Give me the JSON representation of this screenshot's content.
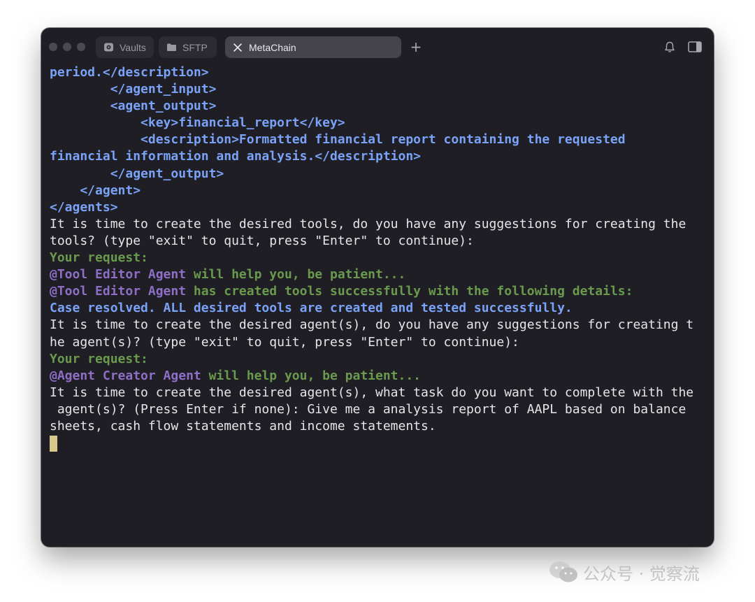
{
  "tabs": [
    {
      "label": "Vaults",
      "icon": "vaults-icon",
      "active": false
    },
    {
      "label": "SFTP",
      "icon": "folder-icon",
      "active": false
    },
    {
      "label": "MetaChain",
      "icon": "close-icon",
      "active": true
    }
  ],
  "toolbar": {
    "new_tab_symbol": "+",
    "icons": [
      "bell-icon",
      "sidebar-toggle-icon"
    ]
  },
  "terminal": {
    "lines": [
      [
        {
          "t": "period.</description>",
          "s": "tag"
        }
      ],
      [
        {
          "t": "        </agent_input>",
          "s": "tag"
        }
      ],
      [
        {
          "t": "        <agent_output>",
          "s": "tag"
        }
      ],
      [
        {
          "t": "            <key>financial_report</key>",
          "s": "tag"
        }
      ],
      [
        {
          "t": "            <description>Formatted financial report containing the requested",
          "s": "tag"
        }
      ],
      [
        {
          "t": "financial information and analysis.</description>",
          "s": "tag"
        }
      ],
      [
        {
          "t": "        </agent_output>",
          "s": "tag"
        }
      ],
      [
        {
          "t": "    </agent>",
          "s": "tag"
        }
      ],
      [
        {
          "t": "</agents>",
          "s": "tag"
        }
      ],
      [
        {
          "t": "It is time to create the desired tools, do you have any suggestions for creating the",
          "s": "plain"
        }
      ],
      [
        {
          "t": "tools? (type \"exit\" to quit, press \"Enter\" to continue):",
          "s": "plain"
        }
      ],
      [
        {
          "t": "Your request:",
          "s": "green"
        }
      ],
      [
        {
          "t": "@Tool Editor Agent",
          "s": "purple"
        },
        {
          "t": " will help you, be patient...",
          "s": "green"
        }
      ],
      [
        {
          "t": "@Tool Editor Agent",
          "s": "purple"
        },
        {
          "t": " has created tools successfully with the following details:",
          "s": "green"
        }
      ],
      [
        {
          "t": "Case resolved. ALL desired tools are created and tested successfully.",
          "s": "blue"
        }
      ],
      [
        {
          "t": "It is time to create the desired agent(s), do you have any suggestions for creating t",
          "s": "plain"
        }
      ],
      [
        {
          "t": "he agent(s)? (type \"exit\" to quit, press \"Enter\" to continue):",
          "s": "plain"
        }
      ],
      [
        {
          "t": "Your request:",
          "s": "green"
        }
      ],
      [
        {
          "t": "@Agent Creator Agent",
          "s": "purple"
        },
        {
          "t": " will help you, be patient...",
          "s": "green"
        }
      ],
      [
        {
          "t": "It is time to create the desired agent(s), what task do you want to complete with the",
          "s": "plain"
        }
      ],
      [
        {
          "t": " agent(s)? (Press Enter if none): Give me a analysis report of AAPL based on balance",
          "s": "plain"
        }
      ],
      [
        {
          "t": "sheets, cash flow statements and income statements.",
          "s": "plain"
        }
      ]
    ]
  },
  "watermark": {
    "text": "公众号 · 觉察流",
    "icon": "wechat-icon"
  },
  "colors": {
    "window_bg": "#1f1e25",
    "tag": "#7aa2f7",
    "green": "#6a9a4d",
    "purple": "#8f6ec5",
    "plain": "#e6e6ea",
    "cursor": "#d8c98a"
  }
}
